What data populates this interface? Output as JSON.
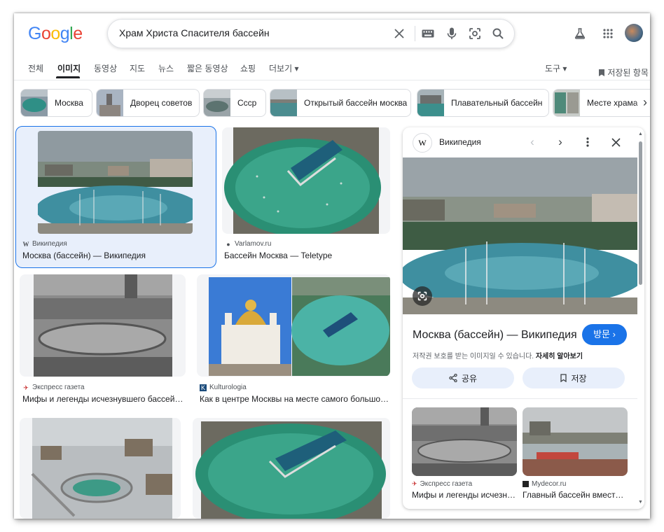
{
  "logo": {
    "letters": [
      "G",
      "o",
      "o",
      "g",
      "l",
      "e"
    ],
    "colors": [
      "#4285f4",
      "#ea4335",
      "#fbbc05",
      "#4285f4",
      "#34a853",
      "#ea4335"
    ]
  },
  "search": {
    "query": "Храм Христа Спасителя бассейн"
  },
  "tabs": [
    {
      "label": "전체"
    },
    {
      "label": "이미지"
    },
    {
      "label": "동영상"
    },
    {
      "label": "지도"
    },
    {
      "label": "뉴스"
    },
    {
      "label": "짧은 동영상"
    },
    {
      "label": "쇼핑"
    },
    {
      "label": "더보기 ▾"
    }
  ],
  "tools_label": "도구 ▾",
  "saved_label": "저장된 항목",
  "chips": [
    {
      "label": "Москва"
    },
    {
      "label": "Дворец советов"
    },
    {
      "label": "Ссср"
    },
    {
      "label": "Открытый бассейн москва"
    },
    {
      "label": "Плавательный бассейн"
    },
    {
      "label": "Месте храма"
    }
  ],
  "results": [
    {
      "source": "Википедия",
      "title": "Москва (бассейн) — Википедия",
      "favicon": "W"
    },
    {
      "source": "Varlamov.ru",
      "title": "Бассейн Москва — Teletype",
      "favicon": "●"
    },
    {
      "source": "Экспресс газета",
      "title": "Мифы и легенды исчезнувшего бассейн…",
      "favicon": "✈"
    },
    {
      "source": "Kulturologia",
      "title": "Как в центре Москвы на месте самого большо…",
      "favicon": "K"
    }
  ],
  "panel": {
    "site": "Википедия",
    "site_logo": "W",
    "title": "Москва (бассейн) — Википедия",
    "visit_label": "방문 ›",
    "copyright_text": "저작권 보호를 받는 이미지일 수 있습니다.",
    "learn_more": "자세히 알아보기",
    "share_label": "공유",
    "save_label": "저장",
    "related": [
      {
        "source": "Экспресс газета",
        "title": "Мифы и легенды исчезн…"
      },
      {
        "source": "Mydecor.ru",
        "title": "Главный бассейн вмест…"
      }
    ]
  },
  "icons": {
    "clear": "close-icon",
    "keyboard": "keyboard-icon",
    "mic": "microphone-icon",
    "lens": "lens-icon",
    "search": "search-icon",
    "labs": "flask-icon",
    "apps": "apps-grid-icon"
  }
}
